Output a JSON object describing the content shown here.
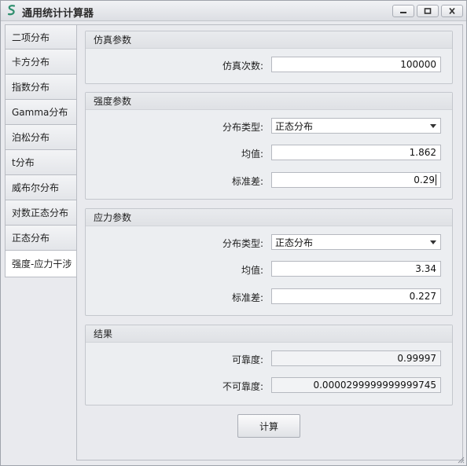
{
  "window": {
    "title": "通用统计计算器",
    "buttons": [
      "minimize",
      "maximize",
      "close"
    ]
  },
  "tabs": [
    {
      "label": "二项分布",
      "active": false
    },
    {
      "label": "卡方分布",
      "active": false
    },
    {
      "label": "指数分布",
      "active": false
    },
    {
      "label": "Gamma分布",
      "active": false
    },
    {
      "label": "泊松分布",
      "active": false
    },
    {
      "label": "t分布",
      "active": false
    },
    {
      "label": "威布尔分布",
      "active": false
    },
    {
      "label": "对数正态分布",
      "active": false
    },
    {
      "label": "正态分布",
      "active": false
    },
    {
      "label": "强度-应力干涉",
      "active": true
    }
  ],
  "simulation": {
    "header": "仿真参数",
    "count_label": "仿真次数:",
    "count_value": "100000"
  },
  "strength": {
    "header": "强度参数",
    "dist_label": "分布类型:",
    "dist_value": "正态分布",
    "mean_label": "均值:",
    "mean_value": "1.862",
    "std_label": "标准差:",
    "std_value": "0.29"
  },
  "stress": {
    "header": "应力参数",
    "dist_label": "分布类型:",
    "dist_value": "正态分布",
    "mean_label": "均值:",
    "mean_value": "3.34",
    "std_label": "标准差:",
    "std_value": "0.227"
  },
  "result": {
    "header": "结果",
    "reliability_label": "可靠度:",
    "reliability_value": "0.99997",
    "unreliability_label": "不可靠度:",
    "unreliability_value": "0.0000299999999999745"
  },
  "actions": {
    "calculate_label": "计算"
  }
}
